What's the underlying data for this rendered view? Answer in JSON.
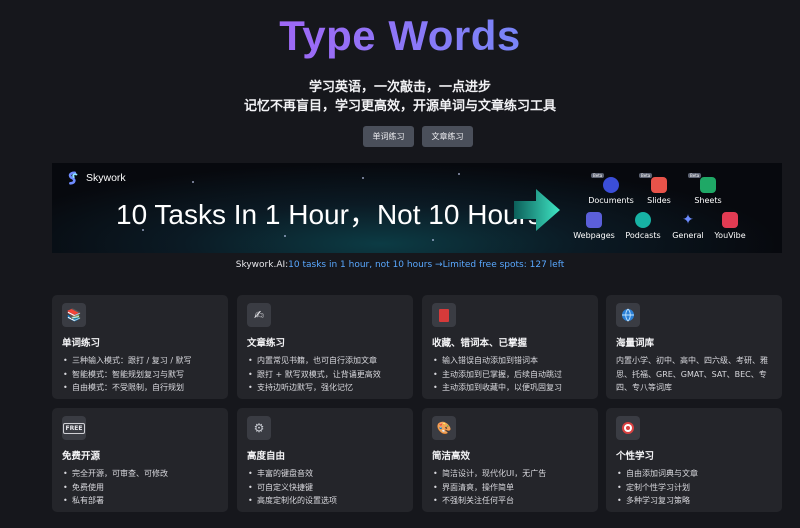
{
  "hero": {
    "title": "Type Words",
    "tagline1": "学习英语，一次敲击，一点进步",
    "tagline2": "记忆不再盲目，学习更高效，开源单词与文章练习工具"
  },
  "buttons": {
    "word_practice": "单词练习",
    "article_practice": "文章练习"
  },
  "banner": {
    "logo": "Skywork",
    "headline": "10 Tasks In 1 Hour，Not 10 Hours",
    "apps": [
      {
        "label": "Documents",
        "icon": "documents-icon",
        "badge": "Beta"
      },
      {
        "label": "Slides",
        "icon": "slides-icon",
        "badge": "Beta"
      },
      {
        "label": "Sheets",
        "icon": "sheets-icon",
        "badge": "Beta"
      },
      {
        "label": "Webpages",
        "icon": "webpages-icon"
      },
      {
        "label": "Podcasts",
        "icon": "podcasts-icon"
      },
      {
        "label": "General",
        "icon": "general-icon"
      },
      {
        "label": "YouVibe",
        "icon": "youvibe-icon"
      }
    ]
  },
  "sponsor": {
    "brand": "Skywork.AI:",
    "text": "10 tasks in 1 hour, not 10 hours →Limited free spots: 127 left"
  },
  "features": [
    {
      "title": "单词练习",
      "icon": "books-icon",
      "items": [
        "三种输入模式：跟打 / 复习 / 默写",
        "智能模式：智能规划复习与默写",
        "自由模式：不受限制，自行规划"
      ]
    },
    {
      "title": "文章练习",
      "icon": "writing-hand-icon",
      "items": [
        "内置常见书籍，也可自行添加文章",
        "跟打 + 默写双模式，让背诵更高效",
        "支持边听边默写，强化记忆"
      ]
    },
    {
      "title": "收藏、错词本、已掌握",
      "icon": "notebook-icon",
      "items": [
        "输入错误自动添加到错词本",
        "主动添加到已掌握，后续自动跳过",
        "主动添加到收藏中，以便巩固复习"
      ]
    },
    {
      "title": "海量词库",
      "icon": "globe-icon",
      "paragraph": "内置小学、初中、高中、四六级、考研、雅思、托福、GRE、GMAT、SAT、BEC、专四、专八等词库"
    },
    {
      "title": "免费开源",
      "icon": "free-icon",
      "items": [
        "完全开源，可审查、可修改",
        "免费使用",
        "私有部署"
      ]
    },
    {
      "title": "高度自由",
      "icon": "gear-icon",
      "items": [
        "丰富的键盘音效",
        "可自定义快捷键",
        "高度定制化的设置选项"
      ]
    },
    {
      "title": "简洁高效",
      "icon": "palette-icon",
      "items": [
        "简洁设计，现代化UI，无广告",
        "界面清爽，操作简单",
        "不强制关注任何平台"
      ]
    },
    {
      "title": "个性学习",
      "icon": "target-icon",
      "items": [
        "自由添加词典与文章",
        "定制个性学习计划",
        "多种学习复习策略"
      ]
    }
  ]
}
